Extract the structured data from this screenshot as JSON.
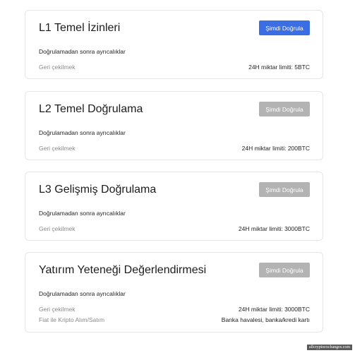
{
  "cards": [
    {
      "title": "L1 Temel İzinleri",
      "button": "Şimdi Doğrula",
      "subtitle": "Doğrulamadan sonra ayrıcalıklar",
      "rows": [
        {
          "key": "Geri çekilmek",
          "value": "24H miktar limiti: 5BTC"
        }
      ]
    },
    {
      "title": "L2 Temel Doğrulama",
      "button": "Şimdi Doğrula",
      "subtitle": "Doğrulamadan sonra ayrıcalıklar",
      "rows": [
        {
          "key": "Geri çekilmek",
          "value": "24H miktar limiti: 200BTC"
        }
      ]
    },
    {
      "title": "L3 Gelişmiş Doğrulama",
      "button": "Şimdi Doğrula",
      "subtitle": "Doğrulamadan sonra ayrıcalıklar",
      "rows": [
        {
          "key": "Geri çekilmek",
          "value": "24H miktar limiti: 3000BTC"
        }
      ]
    },
    {
      "title": "Yatırım Yeteneği Değerlendirmesi",
      "button": "Şimdi Doğrula",
      "subtitle": "Doğrulamadan sonra ayrıcalıklar",
      "rows": [
        {
          "key": "Geri çekilmek",
          "value": "24H miktar limiti: 3000BTC"
        },
        {
          "key": "Fiat ile Kripto Alım/Satım",
          "value": "Banka havalesi, banka/kredi kartı"
        }
      ]
    }
  ],
  "watermark": "allcryptoexchanges.com",
  "colors": {
    "primary": "#3b6de3",
    "disabled": "#b3b3b3"
  }
}
